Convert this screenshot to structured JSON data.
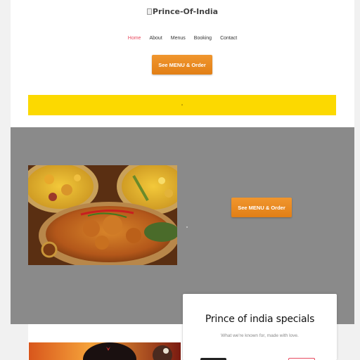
{
  "header": {
    "logo_alt": "Prince-Of-India"
  },
  "nav": {
    "items": [
      {
        "label": "Home",
        "active": true
      },
      {
        "label": "About",
        "active": false
      },
      {
        "label": "Menus",
        "active": false
      },
      {
        "label": "Booking",
        "active": false
      },
      {
        "label": "Contact",
        "active": false
      }
    ]
  },
  "cta": {
    "top_label": "See MENU & Order",
    "hero_label": "See MENU & Order"
  },
  "notice": {
    "text": "×"
  },
  "specials": {
    "title": "Prince of india specials",
    "subtitle": "What we're known for, made with love."
  },
  "colors": {
    "accent_orange": "#e8891f",
    "nav_active": "#e84a5f",
    "notice_yellow": "#fcd900",
    "hero_gray": "#8a8a8a"
  }
}
